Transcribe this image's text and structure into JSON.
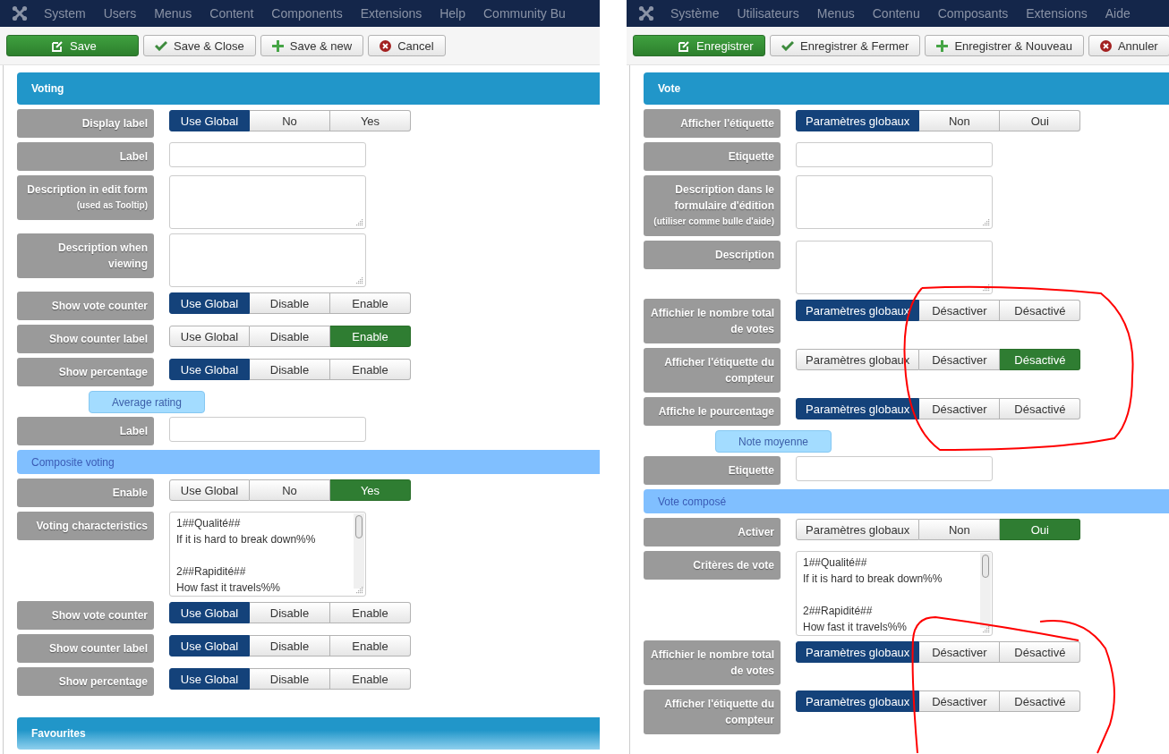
{
  "panels": [
    {
      "menu": [
        "System",
        "Users",
        "Menus",
        "Content",
        "Components",
        "Extensions",
        "Help",
        "Community Bu"
      ],
      "toolbar": [
        {
          "kind": "save",
          "label": "Save"
        },
        {
          "kind": "save-close",
          "label": "Save & Close"
        },
        {
          "kind": "save-new",
          "label": "Save & new"
        },
        {
          "kind": "cancel",
          "label": "Cancel"
        }
      ],
      "form": [
        {
          "kind": "section",
          "title": "Voting"
        },
        {
          "kind": "radio",
          "label": "Display label",
          "options": [
            {
              "label": "Use Global",
              "selected": true
            },
            {
              "label": "No",
              "selected": false
            },
            {
              "label": "Yes",
              "selected": false
            }
          ]
        },
        {
          "kind": "input",
          "label": "Label"
        },
        {
          "kind": "textarea",
          "label": "Description in edit form",
          "note": "(used as Tooltip)"
        },
        {
          "kind": "textarea",
          "label": "Description when viewing"
        },
        {
          "kind": "radio",
          "label": "Show vote counter",
          "options": [
            {
              "label": "Use Global",
              "selected": true
            },
            {
              "label": "Disable",
              "selected": false
            },
            {
              "label": "Enable",
              "selected": false
            }
          ]
        },
        {
          "kind": "radio",
          "label": "Show counter label",
          "options": [
            {
              "label": "Use Global",
              "selected": false
            },
            {
              "label": "Disable",
              "selected": false
            },
            {
              "label": "Enable",
              "selected": true
            }
          ]
        },
        {
          "kind": "radio",
          "label": "Show percentage",
          "options": [
            {
              "label": "Use Global",
              "selected": true
            },
            {
              "label": "Disable",
              "selected": false
            },
            {
              "label": "Enable",
              "selected": false
            }
          ]
        },
        {
          "kind": "subheading",
          "title": "Average rating"
        },
        {
          "kind": "input",
          "label": "Label"
        },
        {
          "kind": "subsection",
          "title": "Composite voting"
        },
        {
          "kind": "radio",
          "label": "Enable",
          "options": [
            {
              "label": "Use Global",
              "selected": false
            },
            {
              "label": "No",
              "selected": false
            },
            {
              "label": "Yes",
              "selected": true
            }
          ]
        },
        {
          "kind": "textarea",
          "label": "Voting characteristics",
          "value": "1##Qualité##\nIf it is hard to break down%%\n\n2##Rapidité##\nHow fast it travels%%"
        },
        {
          "kind": "radio",
          "label": "Show vote counter",
          "options": [
            {
              "label": "Use Global",
              "selected": true
            },
            {
              "label": "Disable",
              "selected": false
            },
            {
              "label": "Enable",
              "selected": false
            }
          ]
        },
        {
          "kind": "radio",
          "label": "Show counter label",
          "options": [
            {
              "label": "Use Global",
              "selected": true
            },
            {
              "label": "Disable",
              "selected": false
            },
            {
              "label": "Enable",
              "selected": false
            }
          ]
        },
        {
          "kind": "radio",
          "label": "Show percentage",
          "options": [
            {
              "label": "Use Global",
              "selected": true
            },
            {
              "label": "Disable",
              "selected": false
            },
            {
              "label": "Enable",
              "selected": false
            }
          ]
        },
        {
          "kind": "spacer"
        },
        {
          "kind": "section",
          "title": "Favourites"
        }
      ]
    },
    {
      "menu": [
        "Système",
        "Utilisateurs",
        "Menus",
        "Contenu",
        "Composants",
        "Extensions",
        "Aide"
      ],
      "toolbar": [
        {
          "kind": "save",
          "label": "Enregistrer"
        },
        {
          "kind": "save-close",
          "label": "Enregistrer & Fermer"
        },
        {
          "kind": "save-new",
          "label": "Enregistrer & Nouveau"
        },
        {
          "kind": "cancel",
          "label": "Annuler"
        }
      ],
      "form": [
        {
          "kind": "section",
          "title": "Vote"
        },
        {
          "kind": "radio",
          "label": "Afficher l'étiquette",
          "options": [
            {
              "label": "Paramètres globaux",
              "selected": true
            },
            {
              "label": "Non",
              "selected": false
            },
            {
              "label": "Oui",
              "selected": false
            }
          ]
        },
        {
          "kind": "input",
          "label": "Etiquette"
        },
        {
          "kind": "textarea",
          "label": "Description dans le formulaire d'édition",
          "note": "(utiliser comme bulle d'aide)"
        },
        {
          "kind": "textarea",
          "label": "Description"
        },
        {
          "kind": "radio",
          "label": "Affichier le nombre total de votes",
          "options": [
            {
              "label": "Paramètres globaux",
              "selected": true
            },
            {
              "label": "Désactiver",
              "selected": false
            },
            {
              "label": "Désactivé",
              "selected": false
            }
          ]
        },
        {
          "kind": "radio",
          "label": "Afficher l'étiquette du compteur",
          "options": [
            {
              "label": "Paramètres globaux",
              "selected": false
            },
            {
              "label": "Désactiver",
              "selected": false
            },
            {
              "label": "Désactivé",
              "selected": true
            }
          ]
        },
        {
          "kind": "radio",
          "label": "Affiche le pourcentage",
          "options": [
            {
              "label": "Paramètres globaux",
              "selected": true
            },
            {
              "label": "Désactiver",
              "selected": false
            },
            {
              "label": "Désactivé",
              "selected": false
            }
          ]
        },
        {
          "kind": "subheading",
          "title": "Note moyenne"
        },
        {
          "kind": "input",
          "label": "Etiquette"
        },
        {
          "kind": "subsection",
          "title": "Vote composé"
        },
        {
          "kind": "radio",
          "label": "Activer",
          "options": [
            {
              "label": "Paramètres globaux",
              "selected": false
            },
            {
              "label": "Non",
              "selected": false
            },
            {
              "label": "Oui",
              "selected": true
            }
          ]
        },
        {
          "kind": "textarea",
          "label": "Critères de vote",
          "value": "1##Qualité##\nIf it is hard to break down%%\n\n2##Rapidité##\nHow fast it travels%%"
        },
        {
          "kind": "radio",
          "label": "Affichier le nombre total de votes",
          "options": [
            {
              "label": "Paramètres globaux",
              "selected": true
            },
            {
              "label": "Désactiver",
              "selected": false
            },
            {
              "label": "Désactivé",
              "selected": false
            }
          ]
        },
        {
          "kind": "radio",
          "label": "Afficher l'étiquette du compteur",
          "options": [
            {
              "label": "Paramètres globaux",
              "selected": true
            },
            {
              "label": "Désactiver",
              "selected": false
            },
            {
              "label": "Désactivé",
              "selected": false
            }
          ]
        }
      ]
    }
  ]
}
